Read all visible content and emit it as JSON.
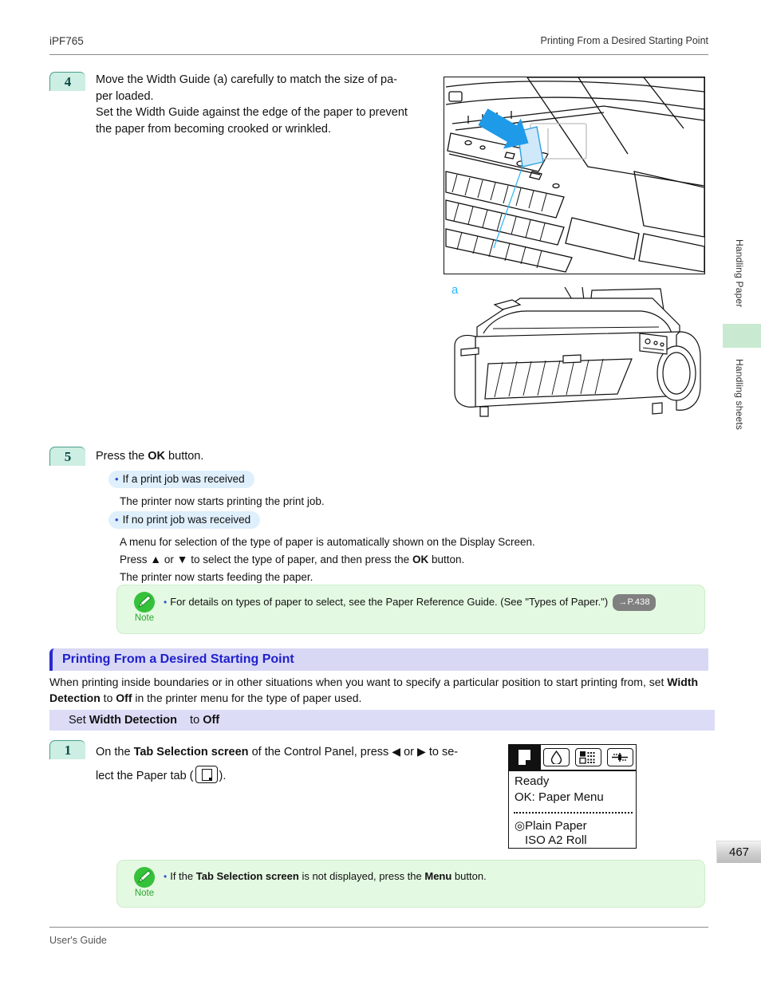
{
  "header": {
    "model": "iPF765",
    "section_title": "Printing From a Desired Starting Point"
  },
  "footer": {
    "guide": "User's Guide",
    "page_number": "467"
  },
  "side_tabs": {
    "items": [
      {
        "label": "Handling Paper"
      },
      {
        "label": "Handling sheets"
      }
    ],
    "highlight_color": "#c9ead1"
  },
  "steps": [
    {
      "number": "4",
      "lines": [
        "Move the Width Guide (a) carefully to match the size of pa-",
        "per loaded.",
        "Set the Width Guide against the edge of the paper to prevent",
        "the paper from becoming crooked or wrinkled."
      ]
    },
    {
      "number": "5",
      "intro_pre": "Press the ",
      "intro_bold": "OK",
      "intro_post": " button.",
      "sub_blocks": [
        {
          "chip": "If a print job was received",
          "lines": [
            "The printer now starts printing the print job."
          ]
        },
        {
          "chip": "If no print job was received",
          "lines": [
            "A menu for selection of the type of paper is automatically shown on the Display Screen.",
            "Press ▲ or ▼ to select the type of paper, and then press the OK button.",
            "The printer now starts feeding the paper."
          ]
        }
      ]
    }
  ],
  "note_1": {
    "label": "Note",
    "bullet": "•",
    "text": "For details on types of paper to select, see the Paper Reference Guide.  (See \"Types of Paper.\")",
    "page_ref": "→P.438"
  },
  "section": {
    "title": "Printing From a Desired Starting Point",
    "paragraph_pre": "When printing inside boundaries or in other situations when you want to specify a particular position to start printing from, set ",
    "paragraph_bold_1": "Width Detection",
    "paragraph_mid": " to ",
    "paragraph_bold_2": "Off",
    "paragraph_post": " in the printer menu for the type of paper used."
  },
  "subsection": {
    "pre": "Set ",
    "bold_1": "Width Detection",
    "mid": " to ",
    "bold_2": "Off"
  },
  "step_1": {
    "number": "1",
    "line1_pre": "On the ",
    "line1_bold": "Tab Selection screen",
    "line1_mid": " of the Control Panel, press ",
    "left_arrow": "◀",
    "line1_or": " or ",
    "right_arrow": "▶",
    "line1_post": " to se-",
    "line2_pre": "lect the Paper tab (",
    "line2_post": ")."
  },
  "lcd": {
    "tabs": [
      {
        "name": "paper-tab",
        "selected": true
      },
      {
        "name": "ink-tab",
        "selected": false
      },
      {
        "name": "job-tab",
        "selected": false
      },
      {
        "name": "settings-tab",
        "selected": false
      }
    ],
    "line_1": "Ready",
    "line_2": "OK: Paper Menu",
    "line_3": "Plain Paper",
    "line_4": "ISO A2 Roll",
    "radio_glyph": "◎"
  },
  "note_2": {
    "label": "Note",
    "bullet": "•",
    "pre": "If the ",
    "bold_1": "Tab Selection screen",
    "mid": " is not displayed, press the ",
    "bold_2": "Menu",
    "post": " button."
  },
  "illustration": {
    "callout_label": "a",
    "callout_color": "#29b6f6",
    "arrow_color": "#1e9ae8"
  }
}
